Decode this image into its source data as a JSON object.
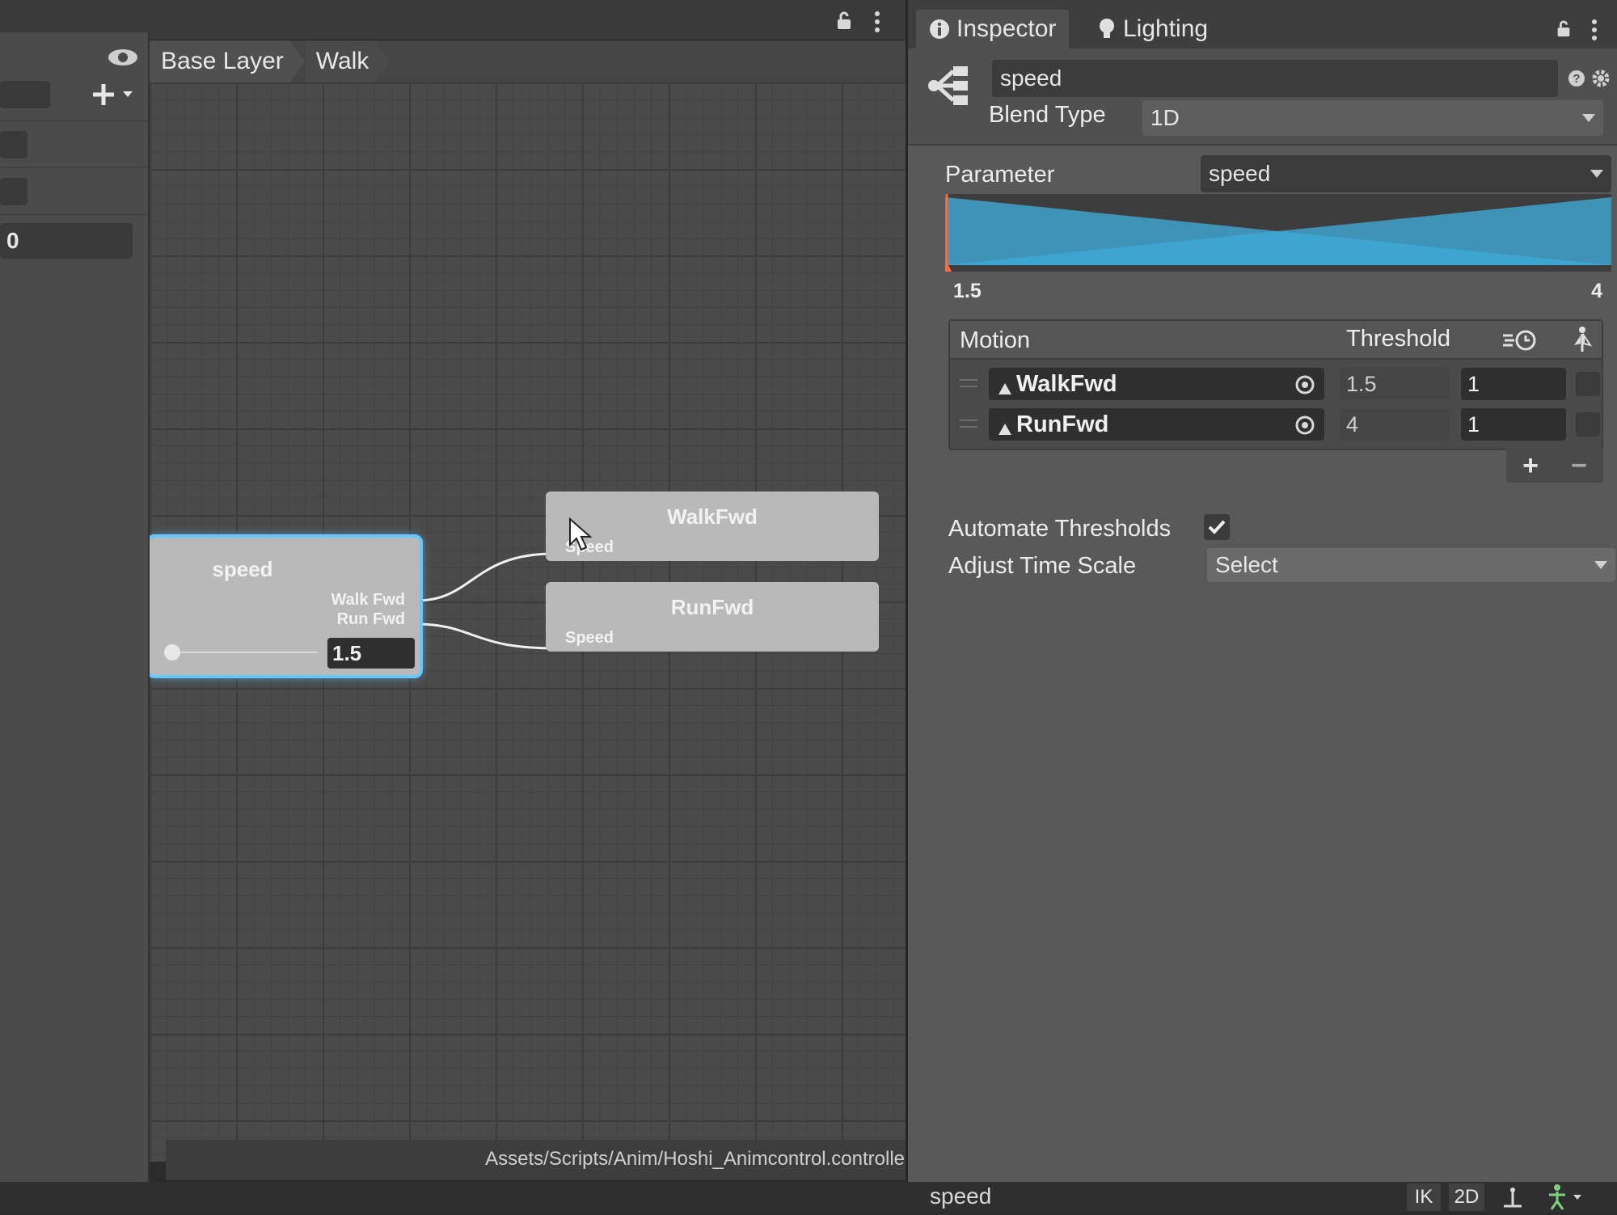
{
  "breadcrumb": [
    "Base Layer",
    "Walk"
  ],
  "left_panel": {
    "value_field": "0"
  },
  "graph": {
    "blend_node": {
      "title": "speed",
      "outputs": [
        "Walk Fwd",
        "Run Fwd"
      ],
      "value": "1.5"
    },
    "motion_nodes": [
      {
        "title": "WalkFwd",
        "port": "Speed"
      },
      {
        "title": "RunFwd",
        "port": "Speed"
      }
    ]
  },
  "path": "Assets/Scripts/Anim/Hoshi_Animcontrol.controller",
  "inspector": {
    "tabs": [
      "Inspector",
      "Lighting"
    ],
    "name": "speed",
    "blend_type_label": "Blend Type",
    "blend_type": "1D",
    "parameter_label": "Parameter",
    "parameter": "speed",
    "range_min": "1.5",
    "range_max": "4",
    "motion_header": "Motion",
    "threshold_header": "Threshold",
    "motions": [
      {
        "name": "WalkFwd",
        "threshold": "1.5",
        "speed": "1"
      },
      {
        "name": "RunFwd",
        "threshold": "4",
        "speed": "1"
      }
    ],
    "add_label": "+",
    "remove_label": "−",
    "automate_thresholds_label": "Automate Thresholds",
    "automate_thresholds": true,
    "adjust_time_scale_label": "Adjust Time Scale",
    "adjust_time_scale": "Select",
    "footer_name": "speed"
  },
  "bottom_toolbar": [
    "IK",
    "2D"
  ],
  "colors": {
    "graph_bg": "#4a4a4a",
    "node_selected": "#64c8ff",
    "blend_fill": "#3fa9d6",
    "threshold_marker": "#ff6a3d"
  }
}
